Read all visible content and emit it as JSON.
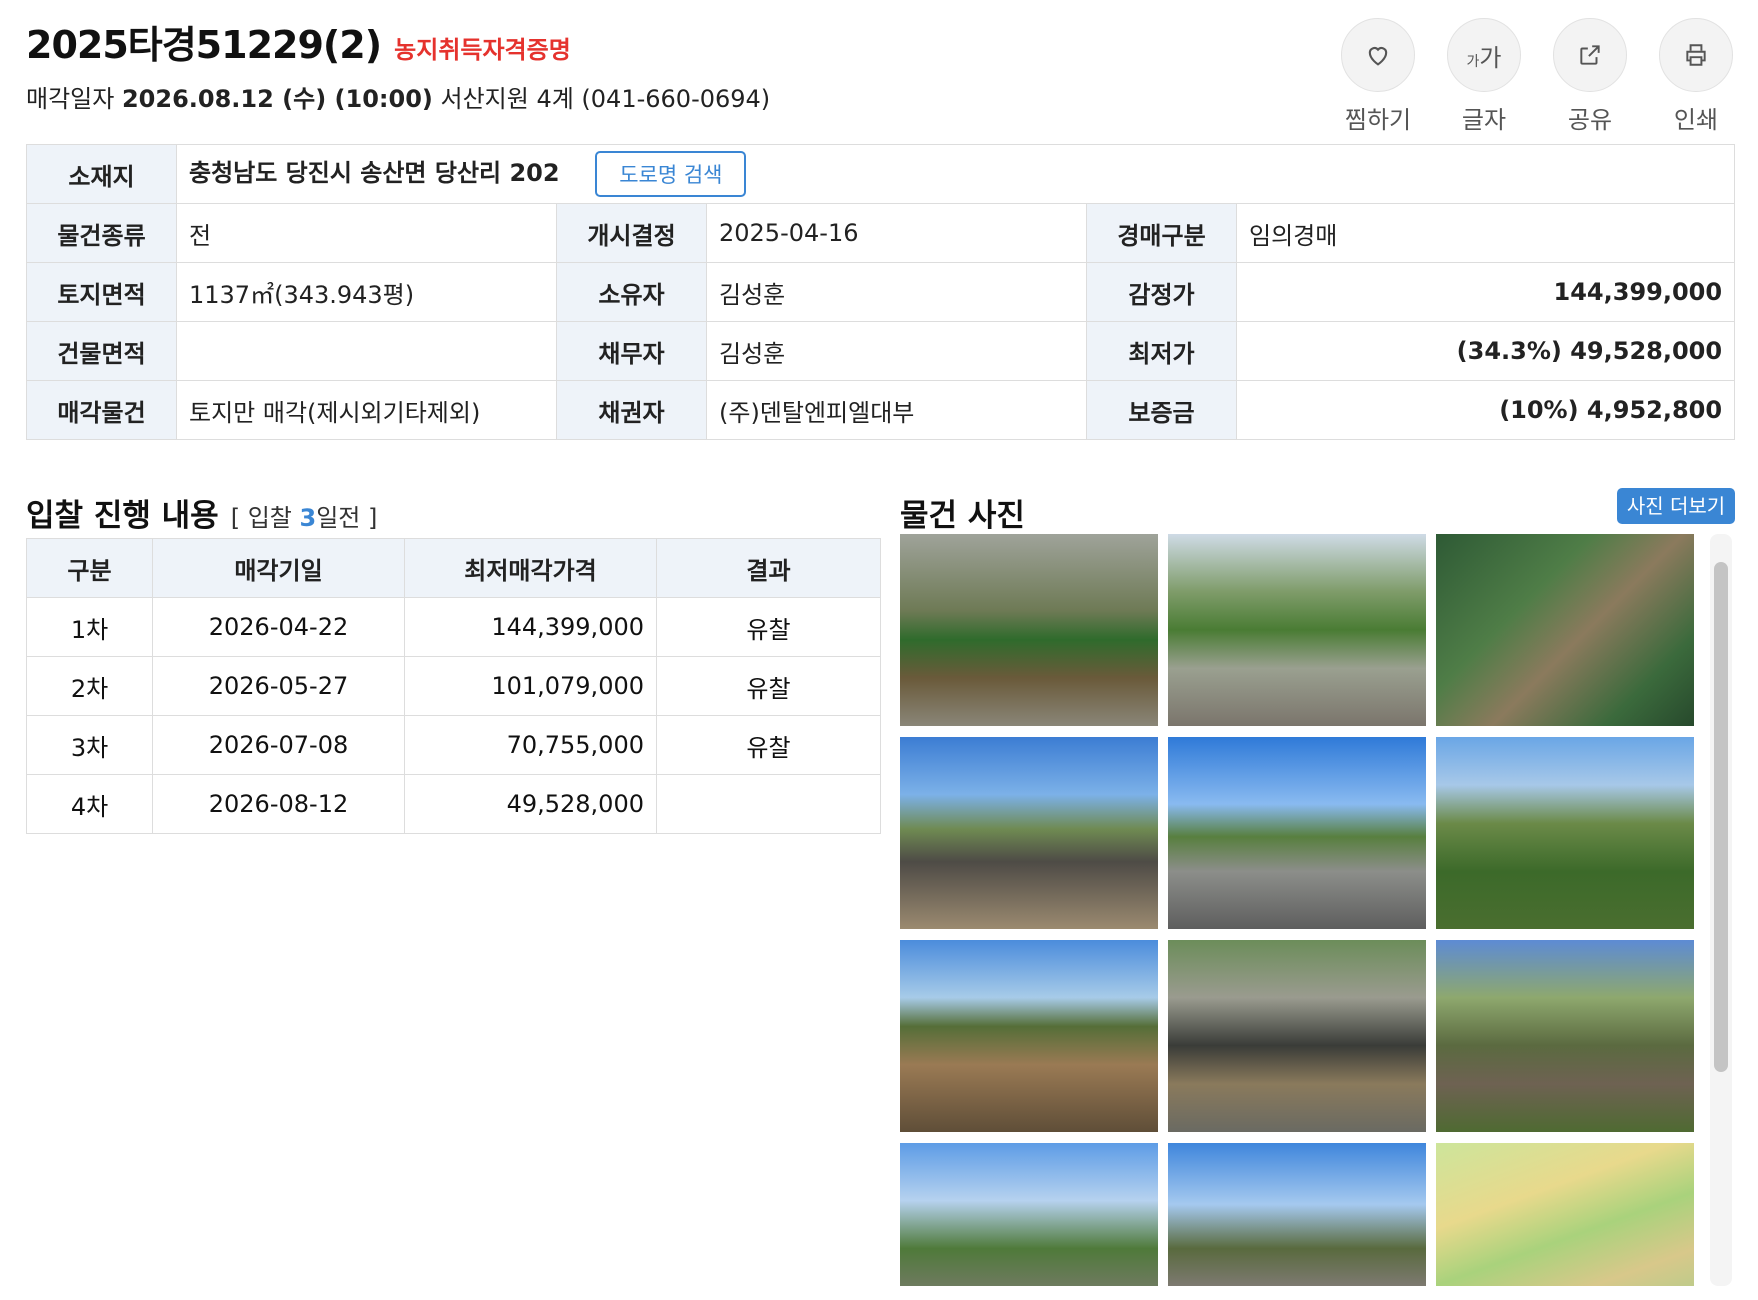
{
  "header": {
    "case_number": "2025타경51229(2)",
    "farm_badge": "농지취득자격증명",
    "sale_label": "매각일자",
    "sale_datetime": "2026.08.12 (수) (10:00)",
    "court": "서산지원 4계 (041-660-0694)"
  },
  "actions": [
    {
      "label": "찜하기",
      "icon": "heart-icon"
    },
    {
      "label": "글자",
      "icon": "font-size-icon",
      "glyph_small": "가",
      "glyph_large": "가"
    },
    {
      "label": "공유",
      "icon": "share-icon"
    },
    {
      "label": "인쇄",
      "icon": "print-icon"
    }
  ],
  "info": {
    "location_label": "소재지",
    "location_value": "충청남도 당진시 송산면 당산리 202",
    "road_search": "도로명 검색",
    "rows": [
      [
        "물건종류",
        "전",
        "개시결정",
        "2025-04-16",
        "경매구분",
        "임의경매"
      ],
      [
        "토지면적",
        "1137㎡(343.943평)",
        "소유자",
        "김성훈",
        "감정가",
        "144,399,000"
      ],
      [
        "건물면적",
        "",
        "채무자",
        "김성훈",
        "최저가",
        "(34.3%) 49,528,000"
      ],
      [
        "매각물건",
        "토지만 매각(제시외기타제외)",
        "채권자",
        "(주)덴탈엔피엘대부",
        "보증금",
        "(10%) 4,952,800"
      ]
    ]
  },
  "bid": {
    "title": "입찰 진행 내용",
    "sub_open": "[ 입찰",
    "sub_count": "3",
    "sub_close": "일전 ]",
    "columns": [
      "구분",
      "매각기일",
      "최저매각가격",
      "결과"
    ],
    "rows": [
      [
        "1차",
        "2026-04-22",
        "144,399,000",
        "유찰"
      ],
      [
        "2차",
        "2026-05-27",
        "101,079,000",
        "유찰"
      ],
      [
        "3차",
        "2026-07-08",
        "70,755,000",
        "유찰"
      ],
      [
        "4차",
        "2026-08-12",
        "49,528,000",
        ""
      ]
    ]
  },
  "photos": {
    "title": "물건 사진",
    "more": "사진 더보기"
  },
  "colors": {
    "accent": "#3a86d4",
    "badge_red": "#e5322d",
    "header_bg": "#eef3f9"
  }
}
